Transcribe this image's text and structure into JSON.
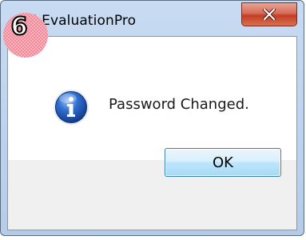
{
  "window": {
    "title": "SM EvaluationPro",
    "close_icon": "close-icon"
  },
  "annotation": {
    "step_number": "6"
  },
  "dialog": {
    "icon": "info-icon",
    "message": "Password Changed.",
    "ok_label": "OK"
  },
  "colors": {
    "title_bar": "#c0d6f0",
    "close_button": "#c94a33",
    "ok_button_border": "#3c7fb1",
    "footer": "#f0f0f0",
    "badge": "#f28a9a"
  }
}
